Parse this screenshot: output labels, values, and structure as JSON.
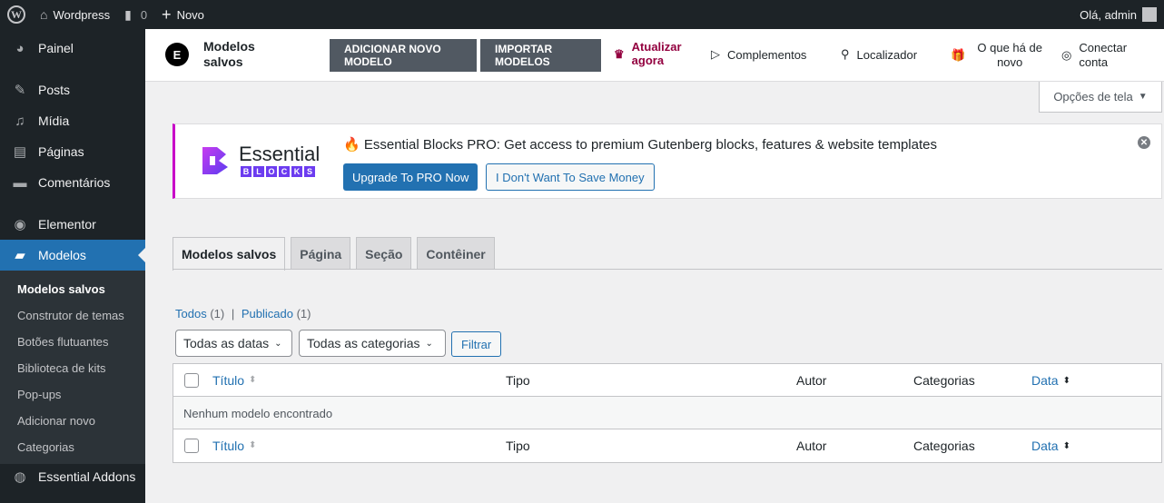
{
  "adminbar": {
    "site_name": "Wordpress",
    "comments_count": "0",
    "new_label": "Novo",
    "greeting": "Olá, admin"
  },
  "sidebar": {
    "items": [
      {
        "label": "Painel",
        "icon": "dashboard-icon"
      },
      {
        "label": "Posts",
        "icon": "pin-icon"
      },
      {
        "label": "Mídia",
        "icon": "media-icon"
      },
      {
        "label": "Páginas",
        "icon": "pages-icon"
      },
      {
        "label": "Comentários",
        "icon": "comment-icon"
      },
      {
        "label": "Elementor",
        "icon": "elementor-icon"
      },
      {
        "label": "Modelos",
        "icon": "folder-icon"
      }
    ],
    "submenu": [
      "Modelos salvos",
      "Construtor de temas",
      "Botões flutuantes",
      "Biblioteca de kits",
      "Pop-ups",
      "Adicionar novo",
      "Categorias"
    ],
    "essential_addons": "Essential Addons"
  },
  "header": {
    "title": "Modelos salvos",
    "add_button": "ADICIONAR NOVO MODELO",
    "import_button": "IMPORTAR MODELOS",
    "upgrade": "Atualizar agora",
    "complements": "Complementos",
    "finder": "Localizador",
    "whats_new": "O que há de novo",
    "connect": "Conectar conta"
  },
  "screen_options": "Opções de tela",
  "notice": {
    "brand_word": "Essential",
    "brand_letters": [
      "B",
      "L",
      "O",
      "C",
      "K",
      "S"
    ],
    "text": "Essential Blocks PRO: Get access to premium Gutenberg blocks, features & website templates",
    "primary_button": "Upgrade To PRO Now",
    "secondary_button": "I Don't Want To Save Money"
  },
  "tabs": [
    "Modelos salvos",
    "Página",
    "Seção",
    "Contêiner"
  ],
  "views": {
    "all_label": "Todos",
    "all_count": "(1)",
    "separator": "|",
    "published_label": "Publicado",
    "published_count": "(1)"
  },
  "filters": {
    "dates": "Todas as datas",
    "categories": "Todas as categorias",
    "filter_button": "Filtrar"
  },
  "table": {
    "columns": [
      "Título",
      "Tipo",
      "Autor",
      "Categorias",
      "Data"
    ],
    "empty_message": "Nenhum modelo encontrado"
  },
  "colors": {
    "admin_dark": "#1d2327",
    "accent_blue": "#2271b1",
    "upgrade_red": "#93003f",
    "notice_border": "#c800c8"
  }
}
